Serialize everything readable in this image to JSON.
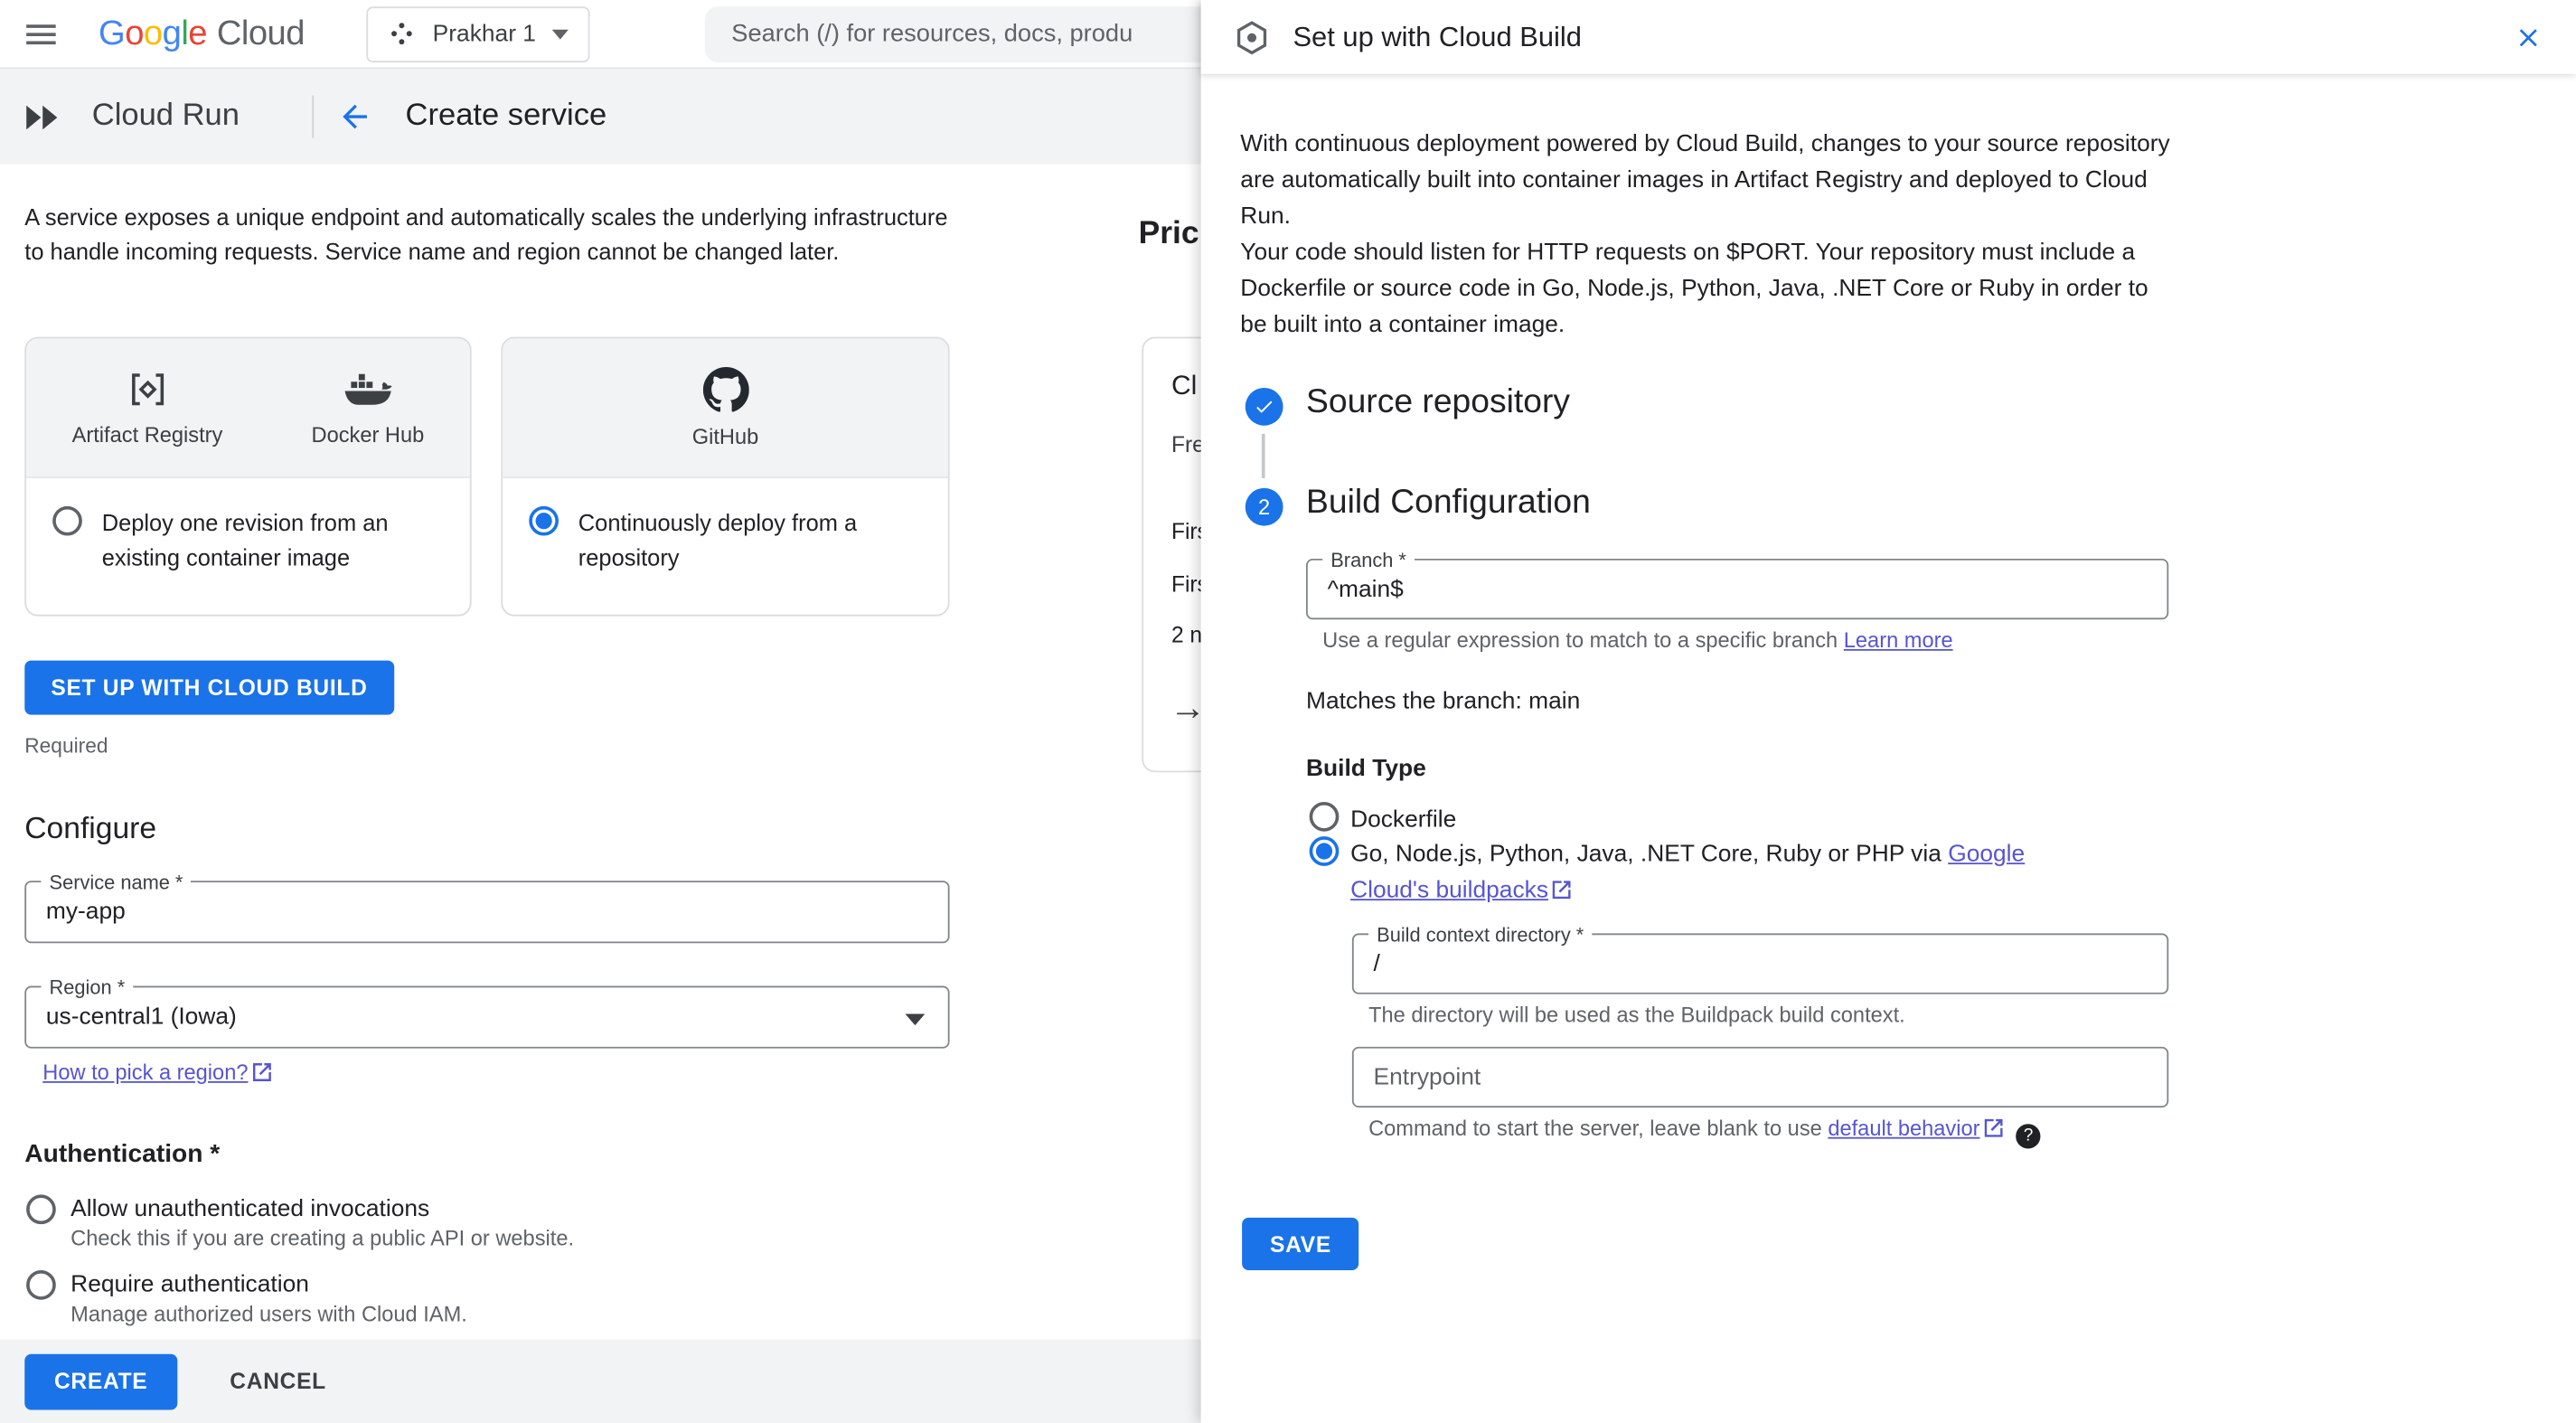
{
  "colors": {
    "primary_button": "#1a73e8",
    "link": "#5755d0",
    "step_circle": "#1a73e8",
    "google_logo": [
      "#4285F4",
      "#EA4335",
      "#FBBC05",
      "#4285F4",
      "#34A853",
      "#EA4335"
    ]
  },
  "icons": {
    "menu-icon": "hamburger",
    "project-icon": "project dots",
    "chevron-down-icon": "▾",
    "cloud-run-icon": "double chevron",
    "back-arrow-icon": "←",
    "artifact-registry-icon": "brackets with diamond",
    "docker-icon": "docker whale",
    "github-icon": "github octocat",
    "cloud-build-icon": "hexagon",
    "close-icon": "✕",
    "external-link-icon": "⧉",
    "help-icon": "?",
    "check-icon": "✓",
    "arrow-right-icon": "→"
  },
  "topbar": {
    "logo_letters": [
      "G",
      "o",
      "o",
      "g",
      "l",
      "e"
    ],
    "logo_cloud": "Cloud",
    "project_name": "Prakhar 1",
    "search_placeholder": "Search (/) for resources, docs, produ"
  },
  "header": {
    "product": "Cloud Run",
    "page_title": "Create service"
  },
  "intro": "A service exposes a unique endpoint and automatically scales the underlying infrastructure to handle incoming requests. Service name and region cannot be changed later.",
  "deploy_cards": {
    "card1": {
      "providers": [
        "Artifact Registry",
        "Docker Hub"
      ],
      "option": "Deploy one revision from an existing container image"
    },
    "card2": {
      "providers": [
        "GitHub"
      ],
      "option": "Continuously deploy from a repository"
    }
  },
  "setup_button": "SET UP WITH CLOUD BUILD",
  "required_note": "Required",
  "configure": {
    "heading": "Configure",
    "service_name_label": "Service name *",
    "service_name_value": "my-app",
    "region_label": "Region *",
    "region_value": "us-central1 (Iowa)",
    "region_link": "How to pick a region?"
  },
  "authentication": {
    "heading": "Authentication *",
    "options": [
      {
        "label": "Allow unauthenticated invocations",
        "description": "Check this if you are creating a public API or website."
      },
      {
        "label": "Require authentication",
        "description": "Manage authorized users with Cloud IAM."
      }
    ]
  },
  "footer": {
    "create": "CREATE",
    "cancel": "CANCEL"
  },
  "pricing": {
    "heading": "Pric",
    "card_title": "Cl",
    "subtitle": "Fre",
    "rows": [
      "Firs",
      "Firs",
      "2 n"
    ],
    "arrow": "→"
  },
  "panel": {
    "title": "Set up with Cloud Build",
    "intro1": "With continuous deployment powered by Cloud Build, changes to your source repository are automatically built into container images in Artifact Registry and deployed to Cloud Run.",
    "intro2": "Your code should listen for HTTP requests on $PORT. Your repository must include a Dockerfile or source code in Go, Node.js, Python, Java, .NET Core or Ruby in order to be built into a container image.",
    "step1_title": "Source repository",
    "step2_number": "2",
    "step2_title": "Build Configuration",
    "branch_label": "Branch *",
    "branch_value": "^main$",
    "branch_helper": "Use a regular expression to match to a specific branch",
    "branch_helper_link": "Learn more",
    "match_note": "Matches the branch: main",
    "build_type_heading": "Build Type",
    "build_type_option1": "Dockerfile",
    "build_type_option2_plain": "Go, Node.js, Python, Java, .NET Core, Ruby or PHP via ",
    "build_type_option2_link": "Google Cloud's buildpacks",
    "context_label": "Build context directory *",
    "context_value": "/",
    "context_helper": "The directory will be used as the Buildpack build context.",
    "entrypoint_label": "Entrypoint",
    "entrypoint_helper": "Command to start the server, leave blank to use ",
    "entrypoint_helper_link": "default behavior",
    "save": "SAVE"
  }
}
